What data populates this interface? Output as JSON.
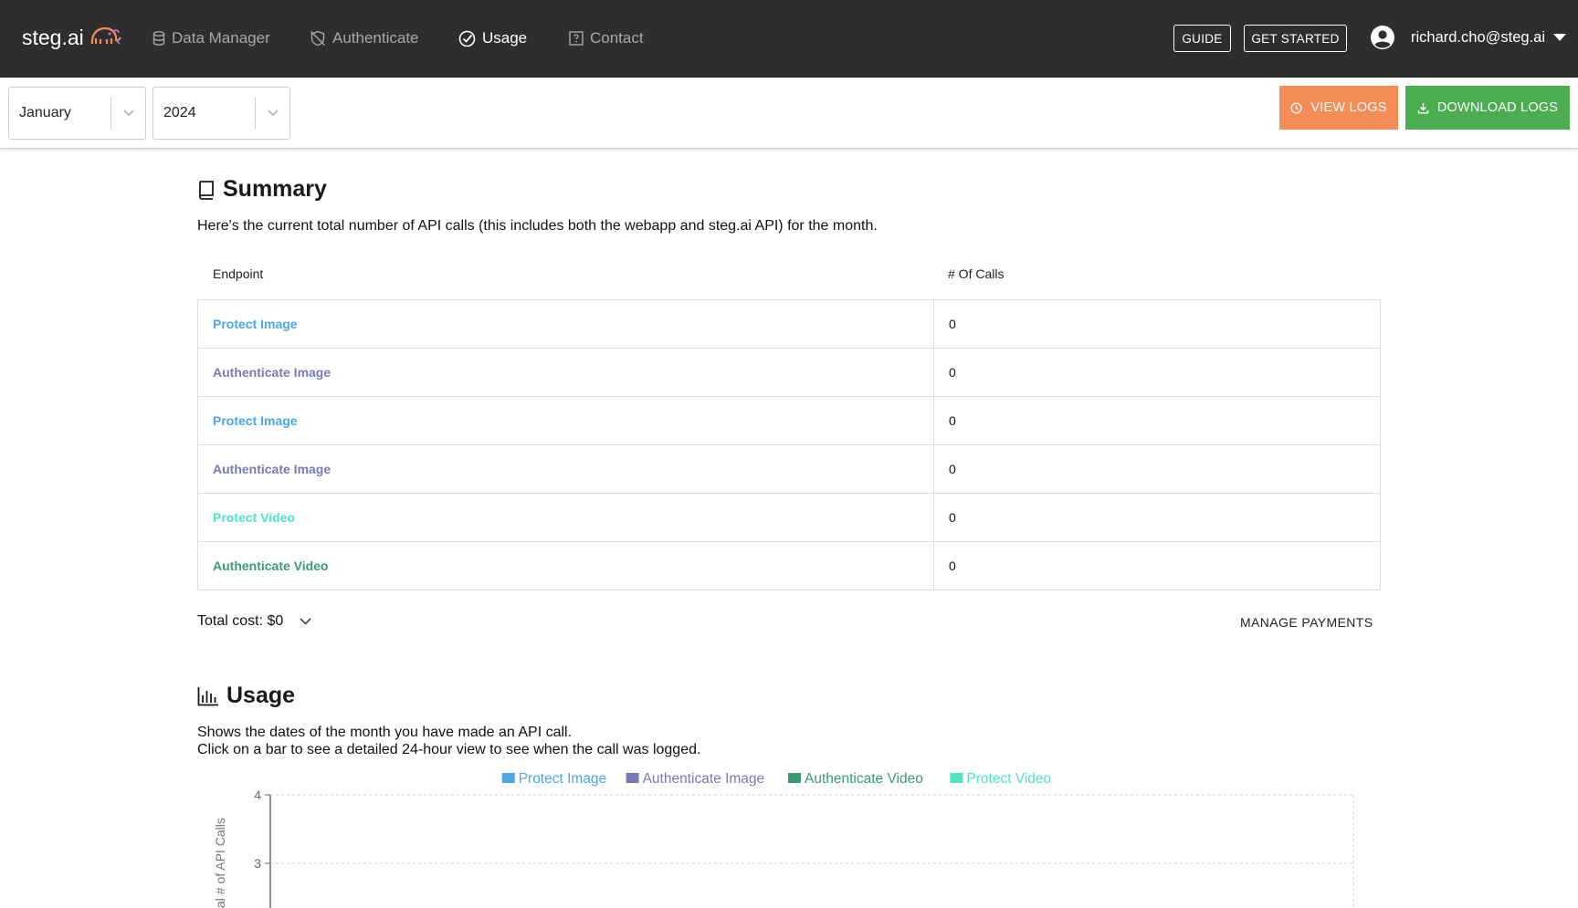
{
  "brand": {
    "name": "steg.ai"
  },
  "nav": {
    "items": [
      {
        "label": "Data Manager"
      },
      {
        "label": "Authenticate"
      },
      {
        "label": "Usage"
      },
      {
        "label": "Contact"
      }
    ],
    "guide_label": "GUIDE",
    "get_started_label": "GET STARTED",
    "user_email": "richard.cho@steg.ai"
  },
  "filters": {
    "month": "January",
    "year": "2024",
    "view_logs_label": "VIEW LOGS",
    "download_logs_label": "DOWNLOAD LOGS"
  },
  "summary": {
    "title": "Summary",
    "description": "Here's the current total number of API calls (this includes both the webapp and steg.ai API) for the month.",
    "headers": {
      "endpoint": "Endpoint",
      "calls": "# Of Calls"
    },
    "rows": [
      {
        "endpoint": "Protect Image",
        "calls": "0",
        "color": "#4aa8e8"
      },
      {
        "endpoint": "Authenticate Image",
        "calls": "0",
        "color": "#7c78b8"
      },
      {
        "endpoint": "Protect Image",
        "calls": "0",
        "color": "#4aa8e8"
      },
      {
        "endpoint": "Authenticate Image",
        "calls": "0",
        "color": "#7c78b8"
      },
      {
        "endpoint": "Protect Video",
        "calls": "0",
        "color": "#4ee6c2"
      },
      {
        "endpoint": "Authenticate Video",
        "calls": "0",
        "color": "#3a9a76"
      }
    ],
    "total_cost": "Total cost: $0",
    "manage_payments": "MANAGE PAYMENTS"
  },
  "usage": {
    "title": "Usage",
    "description_line1": "Shows the dates of the month you have made an API call.",
    "description_line2": "Click on a bar to see a detailed 24-hour view to see when the call was logged."
  },
  "colors": {
    "nav_bg": "#2e2e2e",
    "view_logs": "#f48d58",
    "download_logs": "#4cad50",
    "protect_image": "#4aa8e8",
    "authenticate_image": "#7c78b8",
    "authenticate_video": "#3a9a76",
    "protect_video": "#4ee6c2"
  },
  "chart_data": {
    "type": "bar",
    "legend_position": "top",
    "series": [
      {
        "name": "Protect Image",
        "values": [],
        "color": "#4aa8e8"
      },
      {
        "name": "Authenticate Image",
        "values": [],
        "color": "#7c78b8"
      },
      {
        "name": "Authenticate Video",
        "values": [],
        "color": "#3a9a76"
      },
      {
        "name": "Protect Video",
        "values": [],
        "color": "#4ee6c2"
      }
    ],
    "ylabel": "al # of API Calls",
    "yticks": [
      "4",
      "3"
    ],
    "ylim": [
      0,
      4
    ],
    "grid": true
  }
}
